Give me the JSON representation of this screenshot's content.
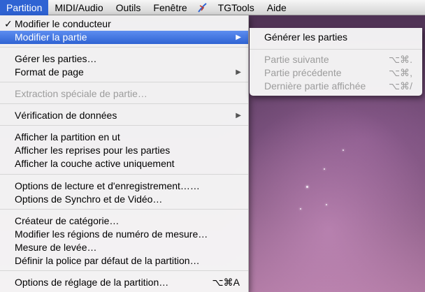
{
  "menubar": {
    "items": [
      "Partition",
      "MIDI/Audio",
      "Outils",
      "Fenêtre",
      "TGTools",
      "Aide"
    ],
    "active_index": 0,
    "icon": "scripts-icon"
  },
  "menu": {
    "check_mark": "✓",
    "arrow": "▶",
    "items": [
      {
        "label": "Modifier le conducteur",
        "checked": true
      },
      {
        "label": "Modifier la partie",
        "highlighted": true,
        "submenu": true
      },
      {
        "label": "Gérer les parties…"
      },
      {
        "label": "Format de page",
        "submenu": true
      },
      {
        "label": "Extraction spéciale de partie…",
        "disabled": true
      },
      {
        "label": "Vérification de données",
        "submenu": true
      },
      {
        "label": "Afficher la partition en ut"
      },
      {
        "label": "Afficher les reprises pour les parties"
      },
      {
        "label": "Afficher la couche active uniquement"
      },
      {
        "label": "Options de lecture et d'enregistrement……"
      },
      {
        "label": "Options de Synchro et de Vidéo…"
      },
      {
        "label": "Créateur de catégorie…"
      },
      {
        "label": "Modifier les régions de numéro de mesure…"
      },
      {
        "label": "Mesure de levée…"
      },
      {
        "label": "Définir la police par défaut de la partition…"
      },
      {
        "label": "Options de réglage de la partition…",
        "shortcut": "⌥⌘A"
      }
    ]
  },
  "submenu": {
    "items": [
      {
        "label": "Générer les parties"
      },
      {
        "label": "Partie suivante",
        "shortcut": "⌥⌘.",
        "disabled": true
      },
      {
        "label": "Partie précédente",
        "shortcut": "⌥⌘,",
        "disabled": true
      },
      {
        "label": "Dernière partie affichée",
        "shortcut": "⌥⌘/",
        "disabled": true
      }
    ]
  },
  "colors": {
    "highlight": "#2f63d3",
    "disabled_text": "#9c9c9c"
  }
}
